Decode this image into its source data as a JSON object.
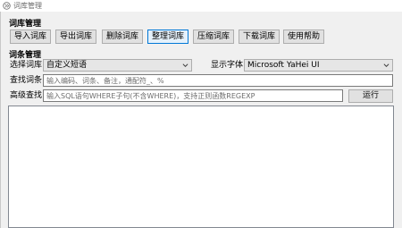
{
  "window": {
    "title": "词库管理",
    "minimize_glyph": "—",
    "maximize_glyph": "☐",
    "close_glyph": "✕"
  },
  "dict_section": {
    "title": "词库管理",
    "buttons": [
      {
        "label": "导入词库"
      },
      {
        "label": "导出词库"
      },
      {
        "label": "删除词库"
      },
      {
        "label": "整理词库"
      },
      {
        "label": "压缩词库"
      },
      {
        "label": "下载词库"
      },
      {
        "label": "使用帮助"
      }
    ]
  },
  "entry_section": {
    "title": "词条管理",
    "select_dict_label": "选择词库",
    "select_dict_value": "自定义短语",
    "font_label": "显示字体",
    "font_value": "Microsoft YaHei UI",
    "find_label": "查找词条",
    "find_placeholder": "输入编码、词条、备注，通配符_、%",
    "advanced_label": "高级查找",
    "advanced_placeholder": "输入SQL语句WHERE子句(不含WHERE)，支持正则函数REGEXP",
    "run_label": "运行"
  },
  "icons": {
    "app": "app-logo-icon",
    "dropdown": "chevron-down-icon"
  }
}
